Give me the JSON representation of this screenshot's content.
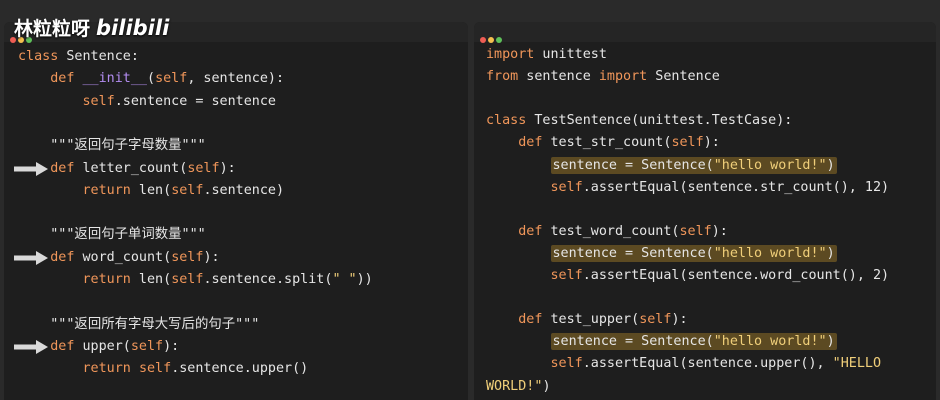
{
  "watermark": {
    "text": "林粒粒呀",
    "logo": "bilibili"
  },
  "left_pane": {
    "lines": [
      {
        "parts": [
          [
            "kw",
            "class"
          ],
          [
            "fn",
            " Sentence:"
          ]
        ]
      },
      {
        "parts": [
          [
            "fn",
            "    "
          ],
          [
            "kw",
            "def"
          ],
          [
            "fn",
            " "
          ],
          [
            "dunder",
            "__init__"
          ],
          [
            "fn",
            "("
          ],
          [
            "self",
            "self"
          ],
          [
            "fn",
            ", sentence):"
          ]
        ]
      },
      {
        "parts": [
          [
            "fn",
            "        "
          ],
          [
            "self",
            "self"
          ],
          [
            "fn",
            ".sentence = sentence"
          ]
        ]
      },
      {
        "parts": []
      },
      {
        "parts": [
          [
            "cm",
            "    \"\"\"返回句子字母数量\"\"\""
          ]
        ]
      },
      {
        "parts": [
          [
            "fn",
            "    "
          ],
          [
            "kw",
            "def"
          ],
          [
            "fn",
            " letter_count("
          ],
          [
            "self",
            "self"
          ],
          [
            "fn",
            "):"
          ]
        ]
      },
      {
        "parts": [
          [
            "fn",
            "        "
          ],
          [
            "kw",
            "return"
          ],
          [
            "fn",
            " len("
          ],
          [
            "self",
            "self"
          ],
          [
            "fn",
            ".sentence)"
          ]
        ]
      },
      {
        "parts": []
      },
      {
        "parts": [
          [
            "cm",
            "    \"\"\"返回句子单词数量\"\"\""
          ]
        ]
      },
      {
        "parts": [
          [
            "fn",
            "    "
          ],
          [
            "kw",
            "def"
          ],
          [
            "fn",
            " word_count("
          ],
          [
            "self",
            "self"
          ],
          [
            "fn",
            "):"
          ]
        ]
      },
      {
        "parts": [
          [
            "fn",
            "        "
          ],
          [
            "kw",
            "return"
          ],
          [
            "fn",
            " len("
          ],
          [
            "self",
            "self"
          ],
          [
            "fn",
            ".sentence.split("
          ],
          [
            "str",
            "\" \""
          ],
          [
            "fn",
            "))"
          ]
        ]
      },
      {
        "parts": []
      },
      {
        "parts": [
          [
            "cm",
            "    \"\"\"返回所有字母大写后的句子\"\"\""
          ]
        ]
      },
      {
        "parts": [
          [
            "fn",
            "    "
          ],
          [
            "kw",
            "def"
          ],
          [
            "fn",
            " upper("
          ],
          [
            "self",
            "self"
          ],
          [
            "fn",
            "):"
          ]
        ]
      },
      {
        "parts": [
          [
            "fn",
            "        "
          ],
          [
            "kw",
            "return"
          ],
          [
            "fn",
            " "
          ],
          [
            "self",
            "self"
          ],
          [
            "fn",
            ".sentence.upper()"
          ]
        ]
      }
    ]
  },
  "right_pane": {
    "lines": [
      {
        "parts": [
          [
            "kw",
            "import"
          ],
          [
            "fn",
            " unittest"
          ]
        ]
      },
      {
        "parts": [
          [
            "kw",
            "from"
          ],
          [
            "fn",
            " sentence "
          ],
          [
            "kw",
            "import"
          ],
          [
            "fn",
            " Sentence"
          ]
        ]
      },
      {
        "parts": []
      },
      {
        "parts": [
          [
            "kw",
            "class"
          ],
          [
            "fn",
            " TestSentence(unittest.TestCase):"
          ]
        ]
      },
      {
        "parts": [
          [
            "fn",
            "    "
          ],
          [
            "kw",
            "def"
          ],
          [
            "fn",
            " test_str_count("
          ],
          [
            "self",
            "self"
          ],
          [
            "fn",
            "):"
          ]
        ]
      },
      {
        "hl": true,
        "indent": "        ",
        "parts": [
          [
            "fn",
            "sentence = Sentence("
          ],
          [
            "str",
            "\"hello world!\""
          ],
          [
            "fn",
            ")"
          ]
        ]
      },
      {
        "parts": [
          [
            "fn",
            "        "
          ],
          [
            "self",
            "self"
          ],
          [
            "fn",
            ".assertEqual(sentence.str_count(), 12)"
          ]
        ]
      },
      {
        "parts": []
      },
      {
        "parts": [
          [
            "fn",
            "    "
          ],
          [
            "kw",
            "def"
          ],
          [
            "fn",
            " test_word_count("
          ],
          [
            "self",
            "self"
          ],
          [
            "fn",
            "):"
          ]
        ]
      },
      {
        "hl": true,
        "indent": "        ",
        "parts": [
          [
            "fn",
            "sentence = Sentence("
          ],
          [
            "str",
            "\"hello world!\""
          ],
          [
            "fn",
            ")"
          ]
        ]
      },
      {
        "parts": [
          [
            "fn",
            "        "
          ],
          [
            "self",
            "self"
          ],
          [
            "fn",
            ".assertEqual(sentence.word_count(), 2)"
          ]
        ]
      },
      {
        "parts": []
      },
      {
        "parts": [
          [
            "fn",
            "    "
          ],
          [
            "kw",
            "def"
          ],
          [
            "fn",
            " test_upper("
          ],
          [
            "self",
            "self"
          ],
          [
            "fn",
            "):"
          ]
        ]
      },
      {
        "hl": true,
        "indent": "        ",
        "parts": [
          [
            "fn",
            "sentence = Sentence("
          ],
          [
            "str",
            "\"hello world!\""
          ],
          [
            "fn",
            ")"
          ]
        ]
      },
      {
        "parts": [
          [
            "fn",
            "        "
          ],
          [
            "self",
            "self"
          ],
          [
            "fn",
            ".assertEqual(sentence.upper(), "
          ],
          [
            "str",
            "\"HELLO"
          ]
        ]
      },
      {
        "parts": [
          [
            "str",
            "WORLD!\""
          ],
          [
            "fn",
            ")"
          ]
        ]
      }
    ]
  },
  "arrows_on_left_lines": [
    5,
    9,
    13
  ],
  "colors": {
    "keyword": "#f0965a",
    "string": "#f0cf7a",
    "dunder": "#b28cf0",
    "text": "#e6e6e6",
    "highlight": "#5c4a22",
    "background": "#1e1e1e"
  }
}
